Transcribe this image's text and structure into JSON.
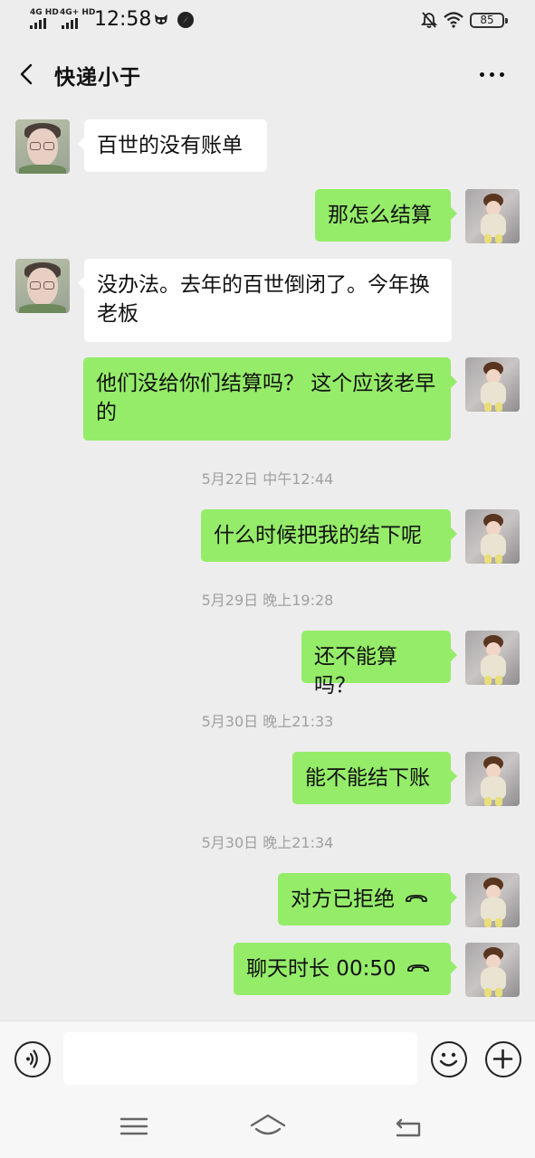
{
  "status_bar": {
    "network1": "4G HD",
    "network2": "4G+ HD",
    "time": "12:58",
    "battery": "85"
  },
  "header": {
    "title": "快递小于"
  },
  "messages": [
    {
      "side": "left",
      "text": "百世的没有账单"
    },
    {
      "side": "right",
      "text": "那怎么结算"
    },
    {
      "side": "left",
      "text": "没办法。去年的百世倒闭了。今年换老板"
    },
    {
      "side": "right",
      "text": "他们没给你们结算吗？ 这个应该老早的"
    },
    {
      "type": "time",
      "text": "5月22日 中午12:44"
    },
    {
      "side": "right",
      "text": "什么时候把我的结下呢"
    },
    {
      "type": "time",
      "text": "5月29日 晚上19:28"
    },
    {
      "side": "right",
      "text": "还不能算吗？"
    },
    {
      "type": "time",
      "text": "5月30日 晚上21:33"
    },
    {
      "side": "right",
      "text": "能不能结下账"
    },
    {
      "type": "time",
      "text": "5月30日 晚上21:34"
    },
    {
      "side": "right",
      "text": "对方已拒绝",
      "icon": "phone-hangup-icon"
    },
    {
      "side": "right",
      "text": "聊天时长 00:50",
      "icon": "phone-hangup-icon"
    }
  ],
  "input": {
    "value": "",
    "placeholder": ""
  },
  "colors": {
    "background": "#ededed",
    "bubble_self": "#95ec69",
    "bubble_other": "#ffffff",
    "timestamp": "#a0a0a0"
  }
}
